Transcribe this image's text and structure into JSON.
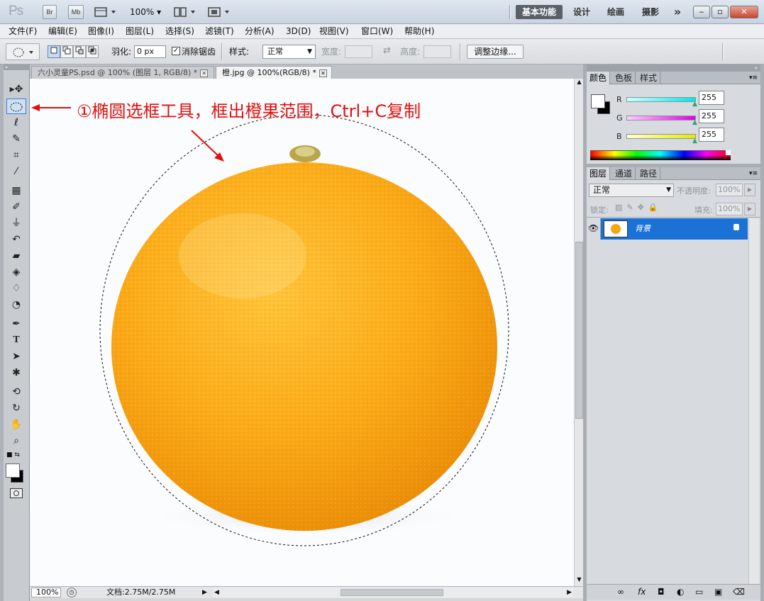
{
  "titlebar": {
    "logo": "Ps",
    "buttons": [
      "Br",
      "Mb"
    ],
    "zoom": "100%",
    "workspaces": [
      "基本功能",
      "设计",
      "绘画",
      "摄影"
    ],
    "more": "»",
    "window_controls": [
      "minimize",
      "restore",
      "close"
    ]
  },
  "menubar": {
    "items": [
      "文件(F)",
      "编辑(E)",
      "图像(I)",
      "图层(L)",
      "选择(S)",
      "滤镜(T)",
      "分析(A)",
      "3D(D)",
      "视图(V)",
      "窗口(W)",
      "帮助(H)"
    ]
  },
  "options": {
    "feather_label": "羽化:",
    "feather_value": "0 px",
    "antialias_label": "消除锯齿",
    "antialias_checked": true,
    "style_label": "样式:",
    "style_value": "正常",
    "width_label": "宽度:",
    "height_label": "高度:",
    "refine_edge": "调整边缘..."
  },
  "tabs": [
    {
      "label": "六小灵童PS.psd @ 100% (图层 1, RGB/8) *",
      "active": false
    },
    {
      "label": "橙.jpg @ 100%(RGB/8) *",
      "active": true
    }
  ],
  "tools": [
    "move-tool",
    "elliptical-marquee-tool",
    "lasso-tool",
    "quick-selection-tool",
    "crop-tool",
    "eyedropper-tool",
    "healing-brush-tool",
    "brush-tool",
    "clone-stamp-tool",
    "history-brush-tool",
    "eraser-tool",
    "paint-bucket-tool",
    "blur-tool",
    "dodge-tool",
    "pen-tool",
    "type-tool",
    "path-selection-tool",
    "shape-tool",
    "3d-rotate-tool",
    "3d-orbit-tool",
    "hand-tool",
    "zoom-tool"
  ],
  "annotation": "①椭圆选框工具，框出橙果范围，Ctrl+C复制",
  "status": {
    "zoom": "100%",
    "doc_info": "文档:2.75M/2.75M"
  },
  "color_panel": {
    "tabs": [
      "颜色",
      "色板",
      "样式"
    ],
    "channels": [
      {
        "name": "R",
        "value": "255",
        "color": "#00e5e5"
      },
      {
        "name": "G",
        "value": "255",
        "color": "#e000e0"
      },
      {
        "name": "B",
        "value": "255",
        "color": "#e8e800"
      }
    ]
  },
  "layers_panel": {
    "tabs": [
      "图层",
      "通道",
      "路径"
    ],
    "blend_mode": "正常",
    "opacity_label": "不透明度:",
    "opacity_value": "100%",
    "lock_label": "锁定:",
    "fill_label": "填充:",
    "fill_value": "100%",
    "layers": [
      {
        "name": "背景",
        "visible": true,
        "locked": true,
        "selected": true
      }
    ]
  },
  "colors": {
    "selection_blue": "#1a72d6",
    "annotation_red": "#e01010",
    "orange": "#f8a513"
  }
}
